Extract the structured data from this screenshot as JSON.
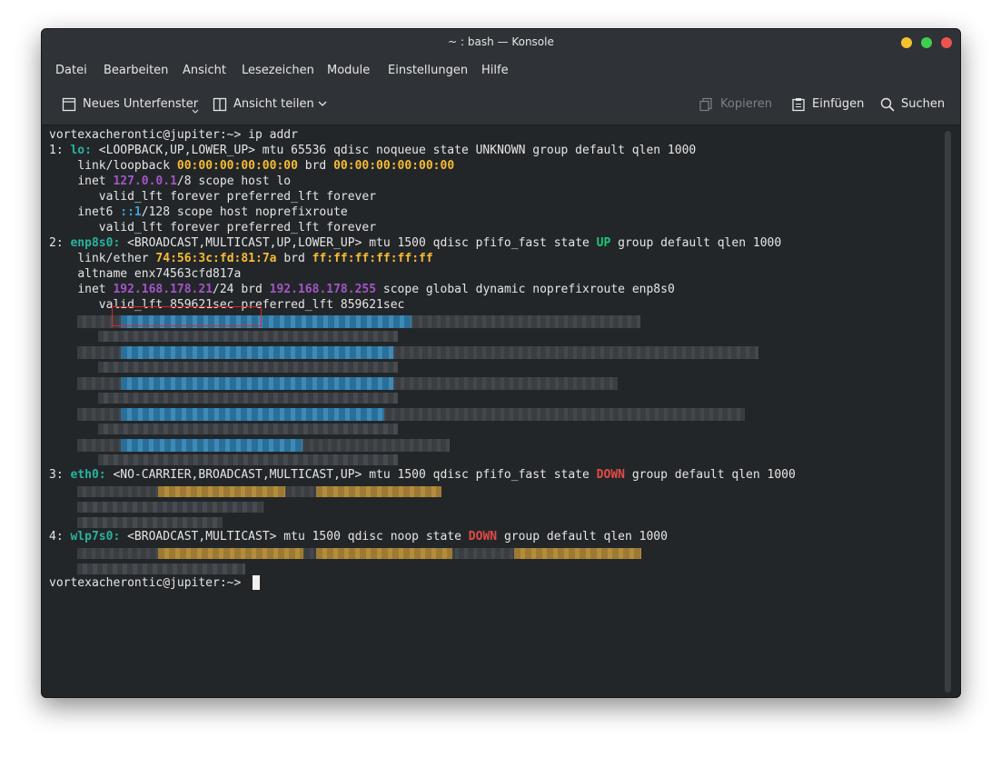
{
  "window": {
    "title": "~ : bash — Konsole"
  },
  "menu": [
    "Datei",
    "Bearbeiten",
    "Ansicht",
    "Lesezeichen",
    "Module",
    "Einstellungen",
    "Hilfe"
  ],
  "toolbar": {
    "new_tab": "Neues Unterfenster",
    "split_view": "Ansicht teilen",
    "copy": "Kopieren",
    "paste": "Einfügen",
    "search": "Suchen"
  },
  "icons": [
    "new-tab-icon",
    "split-view-icon",
    "chevron-down-icon",
    "copy-icon",
    "paste-icon",
    "search-icon"
  ],
  "colors": {
    "interface": "#28b3a0",
    "mac": "#f6bc33",
    "ip": "#a356c4",
    "ipv6": "#3ba3dc",
    "state_up": "#1bc77a",
    "state_down": "#e24b45"
  },
  "terminal": {
    "prompt": "vortexacherontic@jupiter:~>",
    "command": "ip addr",
    "lo": {
      "index": "1:",
      "name": "lo:",
      "flags": "<LOOPBACK,UP,LOWER_UP> mtu 65536 qdisc noqueue state UNKNOWN group default qlen 1000",
      "link_label": "link/loopback",
      "mac": "00:00:00:00:00:00",
      "brd_label": "brd",
      "brd": "00:00:00:00:00:00",
      "inet_label": "inet",
      "ip": "127.0.0.1",
      "ip_rest": "/8 scope host lo",
      "valid1": "valid_lft forever preferred_lft forever",
      "inet6_label": "inet6",
      "ip6": "::1",
      "ip6_rest": "/128 scope host noprefixroute",
      "valid2": "valid_lft forever preferred_lft forever"
    },
    "enp": {
      "index": "2:",
      "name": "enp8s0:",
      "flags": "<BROADCAST,MULTICAST,UP,LOWER_UP> mtu 1500 qdisc pfifo_fast state",
      "state": "UP",
      "after": "group default qlen 1000",
      "link_label": "link/ether",
      "mac": "74:56:3c:fd:81:7a",
      "brd_label": "brd",
      "brd": "ff:ff:ff:ff:ff:ff",
      "altname": "altname enx74563cfd817a",
      "inet_label": "inet",
      "ip": "192.168.178.21",
      "mask": "/24 brd",
      "bcast": "192.168.178.255",
      "inet_rest": "scope global dynamic noprefixroute enp8s0",
      "valid": "valid_lft 859621sec preferred_lft 859621sec"
    },
    "eth": {
      "index": "3:",
      "name": "eth0:",
      "flags": "<NO-CARRIER,BROADCAST,MULTICAST,UP> mtu 1500 qdisc pfifo_fast state",
      "state": "DOWN",
      "after": "group default qlen 1000"
    },
    "wlp": {
      "index": "4:",
      "name": "wlp7s0:",
      "flags": "<BROADCAST,MULTICAST> mtu 1500 qdisc noop state",
      "state": "DOWN",
      "after": "group default qlen 1000"
    },
    "final_prompt": "vortexacherontic@jupiter:~>"
  }
}
